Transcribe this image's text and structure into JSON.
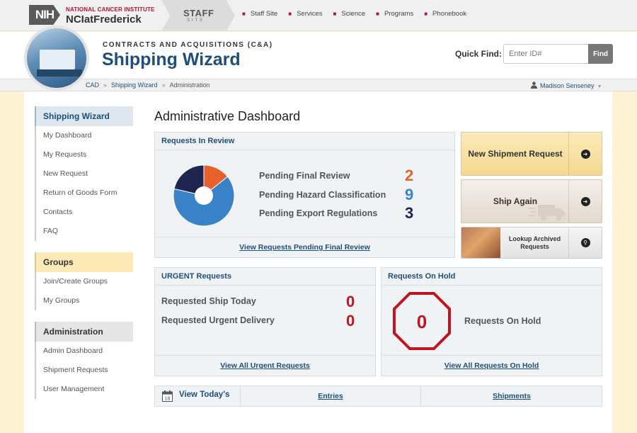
{
  "topbar": {
    "nih_logo": "NIH",
    "org_line1": "NATIONAL CANCER INSTITUTE",
    "org_line2": "NCIatFrederick",
    "staff_title": "STAFF",
    "staff_subtitle": "SITE",
    "nav": [
      "Staff Site",
      "Services",
      "Science",
      "Programs",
      "Phonebook"
    ]
  },
  "header": {
    "subtitle": "CONTRACTS AND ACQUISITIONS (C&A)",
    "title": "Shipping Wizard",
    "quick_find": {
      "label": "Quick Find:",
      "placeholder": "Enter ID#",
      "button": "Find"
    }
  },
  "breadcrumb": [
    "CAD",
    "Shipping Wizard",
    "Administration"
  ],
  "user": {
    "name": "Madison Senseney",
    "icon": "user-icon"
  },
  "sidebar": {
    "groups": [
      {
        "title": "Shipping Wizard",
        "items": [
          "My Dashboard",
          "My Requests",
          "New Request",
          "Return of Goods Form",
          "Contacts",
          "FAQ"
        ]
      },
      {
        "title": "Groups",
        "items": [
          "Join/Create Groups",
          "My Groups"
        ]
      },
      {
        "title": "Administration",
        "items": [
          "Admin Dashboard",
          "Shipment Requests",
          "User Management"
        ]
      }
    ]
  },
  "main": {
    "title": "Administrative Dashboard",
    "review": {
      "header": "Requests In Review",
      "rows": [
        {
          "label": "Pending Final Review",
          "value": "2",
          "color": "#e8612c"
        },
        {
          "label": "Pending Hazard Classification",
          "value": "9",
          "color": "#3a82c8"
        },
        {
          "label": "Pending Export Regulations",
          "value": "3",
          "color": "#1e2550"
        }
      ],
      "footer": "View Requests Pending Final Review"
    },
    "actions": [
      {
        "label": "New Shipment Request",
        "icon": "arrow-right-icon"
      },
      {
        "label": "Ship Again",
        "icon": "arrow-right-icon"
      },
      {
        "label": "Lookup Archived Requests",
        "icon": "search-icon"
      }
    ],
    "urgent": {
      "header": "URGENT Requests",
      "rows": [
        {
          "label": "Requested Ship Today",
          "value": "0"
        },
        {
          "label": "Requested Urgent Delivery",
          "value": "0"
        }
      ],
      "footer": "View All Urgent Requests"
    },
    "hold": {
      "header": "Requests On Hold",
      "count": "0",
      "label": "Requests On Hold",
      "footer": "View All Requests On Hold"
    },
    "today": {
      "label": "View Today's",
      "entries": "Entries",
      "shipments": "Shipments"
    }
  },
  "colors": {
    "accent": "#1f4e79",
    "urgent": "#c0141e",
    "brand_red": "#b0142a"
  }
}
